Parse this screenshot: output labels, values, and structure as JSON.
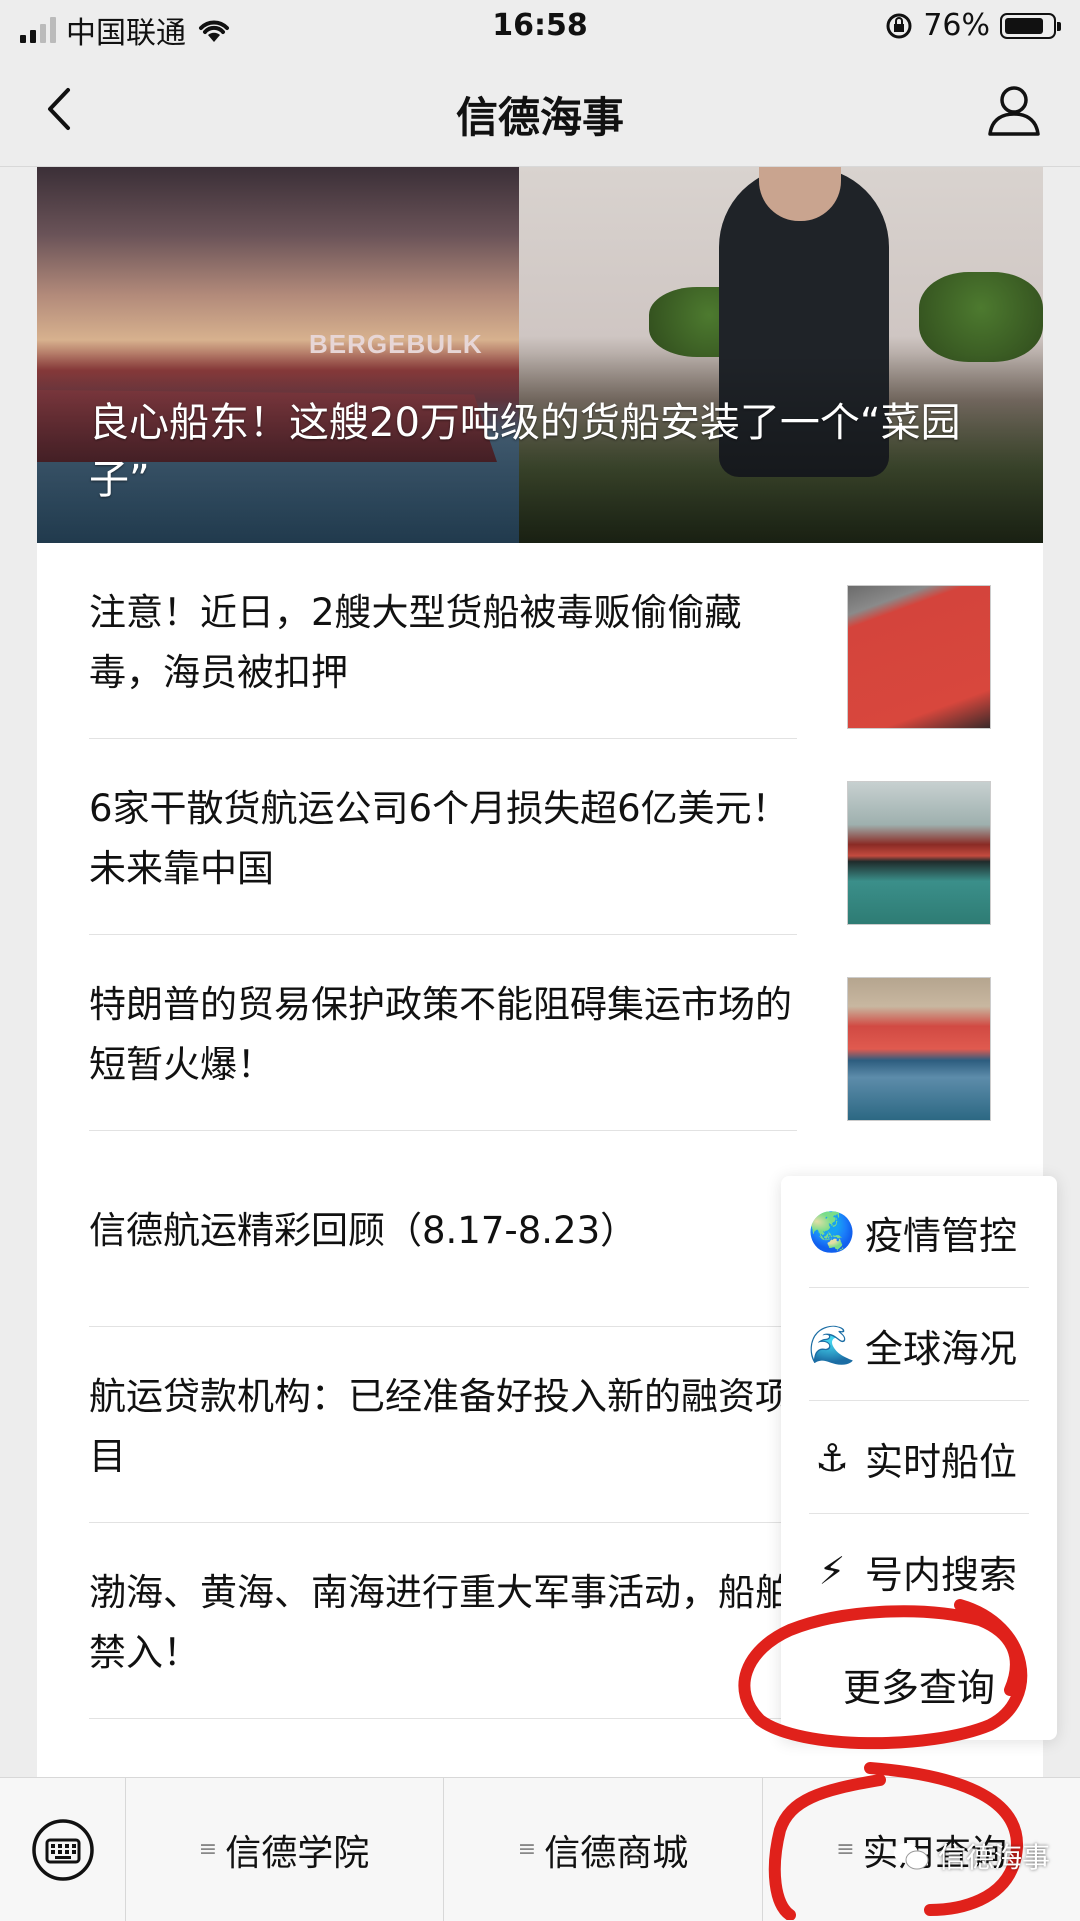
{
  "status": {
    "carrier": "中国联通",
    "time": "16:58",
    "battery": "76%"
  },
  "nav": {
    "title": "信德海事"
  },
  "hero": {
    "title": "良心船东！这艘20万吨级的货船安装了一个“菜园子”",
    "ship_name": "BERGEBULK"
  },
  "articles": [
    {
      "title": "注意！近日，2艘大型货船被毒贩偷偷藏毒，海员被扣押",
      "thumb": "red-hull"
    },
    {
      "title": "6家干散货航运公司6个月损失超6亿美元！未来靠中国",
      "thumb": "bulk-carrier"
    },
    {
      "title": "特朗普的贸易保护政策不能阻碍集运市场的短暂火爆！",
      "thumb": "container-ship"
    },
    {
      "title": "信德航运精彩回顾（8.17-8.23）",
      "thumb": ""
    },
    {
      "title": "航运贷款机构：已经准备好投入新的融资项目",
      "thumb": ""
    },
    {
      "title": "渤海、黄海、南海进行重大军事活动，船舶禁入！",
      "thumb": ""
    }
  ],
  "popup": {
    "items": [
      {
        "icon": "🌏",
        "label": "疫情管控"
      },
      {
        "icon": "🌊",
        "label": "全球海况"
      },
      {
        "icon": "⚓",
        "label": "实时船位"
      },
      {
        "icon": "⚡",
        "label": "号内搜索"
      }
    ],
    "more": "更多查询"
  },
  "bottom_menu": [
    "信德学院",
    "信德商城",
    "实用查询"
  ],
  "watermark": "信德海事",
  "colors": {
    "annotation": "#e0211b",
    "background": "#ededed"
  }
}
